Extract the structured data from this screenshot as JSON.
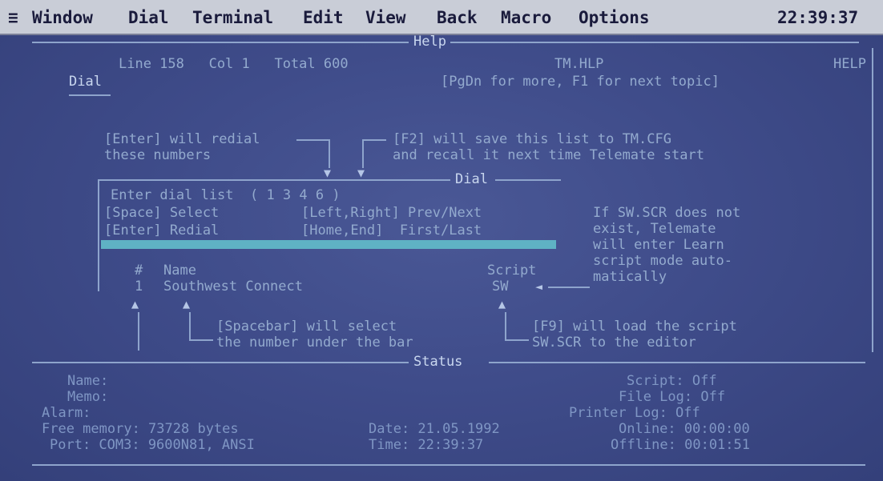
{
  "menubar": {
    "system_icon": "≡",
    "items": [
      "Window",
      "Dial",
      "Terminal",
      "Edit",
      "View",
      "Back",
      "Macro",
      "Options"
    ],
    "clock": "22:39:37"
  },
  "help_window": {
    "title": "Help",
    "status_line": "Line 158   Col 1   Total 600",
    "file": "TM.HLP",
    "badge": "HELP",
    "topic": "Dial",
    "hint": "[PgDn for more, F1 for next topic]"
  },
  "annotations": {
    "enter_redial": [
      "[Enter] will redial",
      "these numbers"
    ],
    "f2_save": [
      "[F2] will save this list to TM.CFG",
      "and recall it next time Telemate start"
    ],
    "script_missing": [
      "If SW.SCR does not",
      "exist, Telemate",
      "will enter Learn",
      "script mode auto-",
      "matically"
    ],
    "spacebar_select": [
      "[Spacebar] will select",
      "the number under the bar"
    ],
    "f9_load": [
      "[F9] will load the script",
      "SW.SCR to the editor"
    ]
  },
  "dial_window": {
    "title": "Dial",
    "enter_list": "Enter dial list  ( 1 3 4 6 )",
    "keys_row1": [
      "[Space] Select",
      "[Left,Right] Prev/Next"
    ],
    "keys_row2": [
      "[Enter] Redial",
      "[Home,End]  First/Last"
    ],
    "columns": [
      "#",
      "Name",
      "Script"
    ],
    "entries": [
      {
        "num": "1",
        "name": "Southwest Connect",
        "script": "SW"
      }
    ]
  },
  "status_window": {
    "title": "Status",
    "left": {
      "name_label": "Name:",
      "memo_label": "Memo:",
      "alarm_label": "Alarm:",
      "free_memory": "Free memory: 73728 bytes",
      "port": "Port: COM3: 9600N81, ANSI"
    },
    "middle": {
      "date": "Date: 21.05.1992",
      "time": "Time: 22:39:37"
    },
    "right": {
      "script": "Script: Off",
      "file_log": "File Log: Off",
      "printer_log": "Printer Log: Off",
      "online": "Online: 00:00:00",
      "offline": "Offline: 00:01:51"
    }
  }
}
